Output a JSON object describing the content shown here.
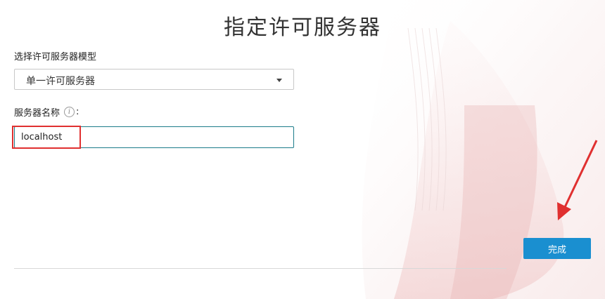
{
  "dialog": {
    "title": "指定许可服务器"
  },
  "server_model": {
    "label": "选择许可服务器模型",
    "selected": "单一许可服务器"
  },
  "server_name": {
    "label": "服务器名称",
    "colon": ":",
    "value": "localhost",
    "info_icon": "info-icon"
  },
  "actions": {
    "finish_label": "完成"
  },
  "colors": {
    "accent": "#1a8fd0",
    "input_focus": "#1b7b8a",
    "annotation": "#e03030"
  }
}
